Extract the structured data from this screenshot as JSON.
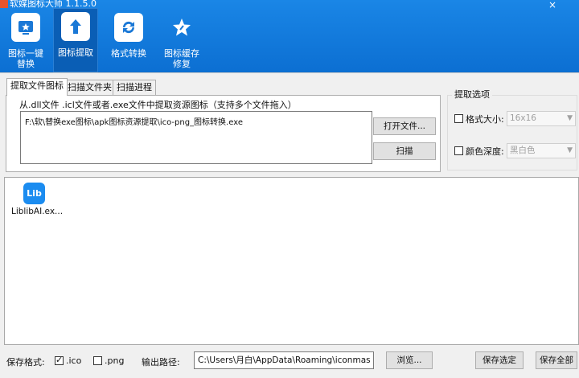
{
  "window": {
    "title": "软媒图标大师 1.1.5.0",
    "close": "×"
  },
  "toolbar": {
    "items": [
      {
        "label": "图标一键\n替换"
      },
      {
        "label": "图标提取"
      },
      {
        "label": "格式转换"
      },
      {
        "label": "图标缓存\n修复"
      }
    ]
  },
  "tabs": [
    "提取文件图标",
    "扫描文件夹",
    "扫描进程"
  ],
  "extract": {
    "caption": "从.dll文件 .icl文件或者.exe文件中提取资源图标（支持多个文件拖入）",
    "path": "F:\\软\\替换exe图标\\apk图标资源提取\\ico-png_图标转换.exe",
    "open_button": "打开文件...",
    "scan_button": "扫描"
  },
  "options": {
    "title": "提取选项",
    "size_label": "格式大小:",
    "size_value": "16x16",
    "depth_label": "颜色深度:",
    "depth_value": "黑白色"
  },
  "list": {
    "items": [
      {
        "icon_text": "Lib",
        "label": "LiblibAI.ex..."
      }
    ]
  },
  "bottom": {
    "save_format_label": "保存格式:",
    "ico_label": ".ico",
    "png_label": ".png",
    "output_label": "输出路径:",
    "output_path": "C:\\Users\\月白\\AppData\\Roaming\\iconmas",
    "browse": "浏览...",
    "save_selected": "保存选定",
    "save_all": "保存全部"
  }
}
